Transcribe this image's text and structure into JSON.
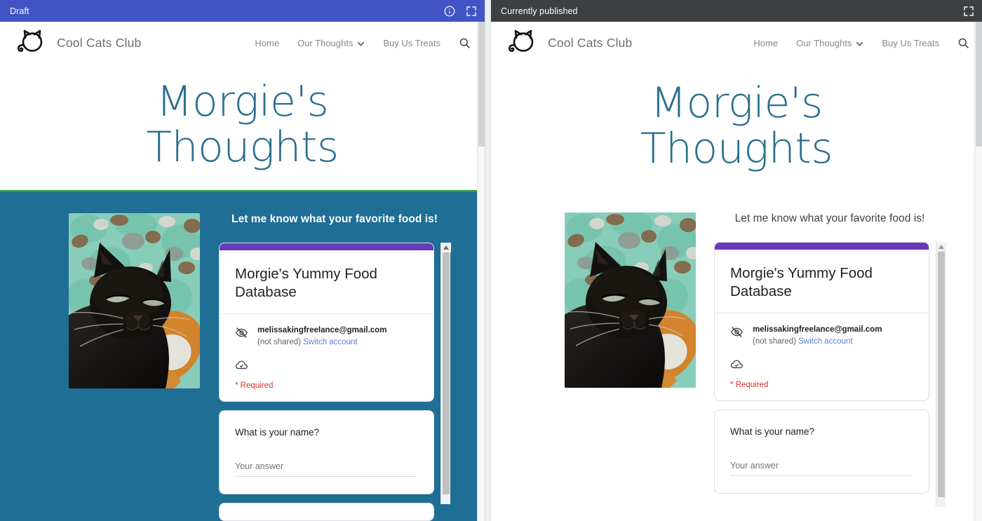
{
  "panels": [
    {
      "status_label": "Draft",
      "status_bar_color": "#4253c5",
      "icons": [
        "info-icon",
        "fullscreen-icon"
      ],
      "section_background": "#1e6e96",
      "prompt_on_teal": true
    },
    {
      "status_label": "Currently published",
      "status_bar_color": "#3c4043",
      "icons": [
        "fullscreen-icon"
      ],
      "section_background": "#ffffff",
      "prompt_on_teal": false
    }
  ],
  "site": {
    "brand": "Cool Cats Club",
    "logo_icon": "cat-head-logo-icon",
    "nav": [
      {
        "label": "Home",
        "has_chevron": false
      },
      {
        "label": "Our Thoughts",
        "has_chevron": true
      },
      {
        "label": "Buy Us Treats",
        "has_chevron": false
      }
    ],
    "search_icon": "search-icon",
    "hero_title_line1": "Morgie's",
    "hero_title_line2": "Thoughts",
    "hero_title_color": "#2a6f8e"
  },
  "section": {
    "prompt": "Let me know what your favorite food is!",
    "photo_alt": "black-cat-on-mint-blanket-photo",
    "divider_color": "#2e9e3e"
  },
  "form": {
    "accent_color": "#673ab7",
    "title": "Morgie's Yummy Food Database",
    "visibility_icon": "eye-off-icon",
    "email": "melissakingfreelance@gmail.com",
    "shared_state": "(not shared)",
    "switch_account_link": "Switch account",
    "cloud_icon": "cloud-done-icon",
    "required_note": "* Required",
    "questions": [
      {
        "label": "What is your name?",
        "answer_placeholder": "Your answer"
      }
    ]
  }
}
